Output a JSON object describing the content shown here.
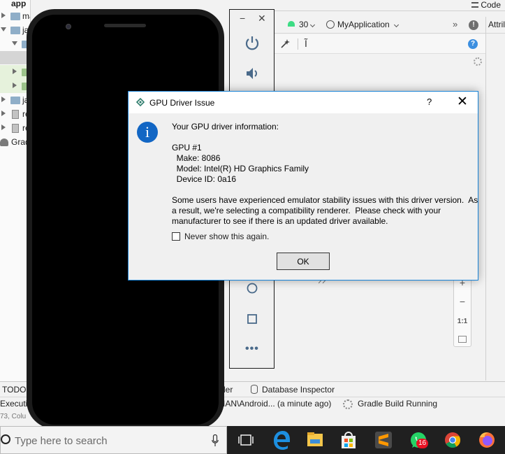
{
  "project_tree": {
    "root_label": "app",
    "rows": [
      {
        "label": "ma"
      },
      {
        "label": "ja"
      },
      {
        "label": ""
      },
      {
        "label": ""
      },
      {
        "label": ""
      },
      {
        "label": ""
      },
      {
        "label": "ja"
      },
      {
        "label": "re"
      },
      {
        "label": "re"
      },
      {
        "label": "Grad"
      }
    ]
  },
  "ide": {
    "code_tab": "Code",
    "api_level": "30",
    "module": "MyApplication",
    "more": "»",
    "attributes_tab": "Attril",
    "margin_icon_glyph": "Ĩ"
  },
  "zoom_panel": {
    "zoom_in": "+",
    "zoom_out": "−",
    "zoom_fit": "1:1"
  },
  "tool_tabs": {
    "todo": "TODO",
    "profiler": "ler",
    "database_inspector": "Database Inspector"
  },
  "status_bar": {
    "left": "Executi",
    "path": "IAN\\Android... (a minute ago)",
    "gradle": "Gradle Build Running",
    "cursor": "73, Colu"
  },
  "emulator": {
    "minimize": "−",
    "close": "✕",
    "more": "•••"
  },
  "taskbar": {
    "search_placeholder": "Type here to search",
    "whatsapp_badge": "16"
  },
  "dialog": {
    "title": "GPU Driver Issue",
    "help": "?",
    "close": "✕",
    "info_glyph": "i",
    "heading": "Your GPU driver information:",
    "gpu_label": "GPU #1",
    "make": "  Make: 8086",
    "model": "  Model: Intel(R) HD Graphics Family",
    "device_id": "  Device ID: 0a16",
    "message_line1": "Some users have experienced emulator stability issues with this driver version.  As",
    "message_line2": "a result, we're selecting a compatibility renderer.  Please check with your",
    "message_line3": "manufacturer to see if there is an updated driver available.",
    "checkbox_label": "Never show this again.",
    "checkbox_checked": false,
    "ok_label": "OK"
  },
  "colors": {
    "dialog_border": "#1883d7",
    "info_icon": "#1266c4",
    "android_green": "#3ddc84",
    "taskbar": "#202020"
  }
}
